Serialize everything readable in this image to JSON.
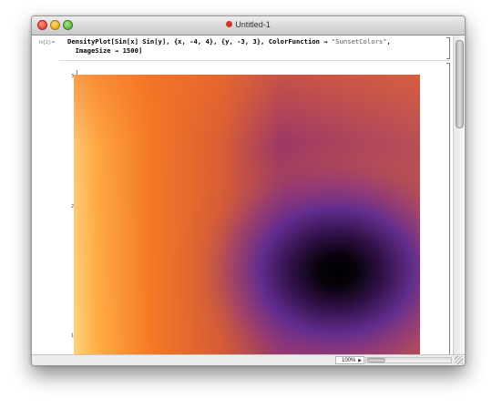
{
  "window": {
    "title": "Untitled-1"
  },
  "input": {
    "label": "In[1]:=",
    "code_line1_a": "DensityPlot[Sin[x] Sin[y], {x, -4, 4}, {y, -3, 3}, ColorFunction → ",
    "code_line1_str": "\"SunsetColors\"",
    "code_line1_b": ",",
    "code_line2": "  ImageSize → 1500]"
  },
  "plot": {
    "ticks": [
      "3",
      "2",
      "1"
    ],
    "colormap": "SunsetColors",
    "function": "Sin[x] Sin[y]",
    "x_range": [
      -4,
      4
    ],
    "y_range": [
      -3,
      3
    ],
    "visible_x_range": [
      -4,
      0.2
    ],
    "visible_y_range": [
      0.9,
      3
    ]
  },
  "status": {
    "zoom": "100%"
  }
}
